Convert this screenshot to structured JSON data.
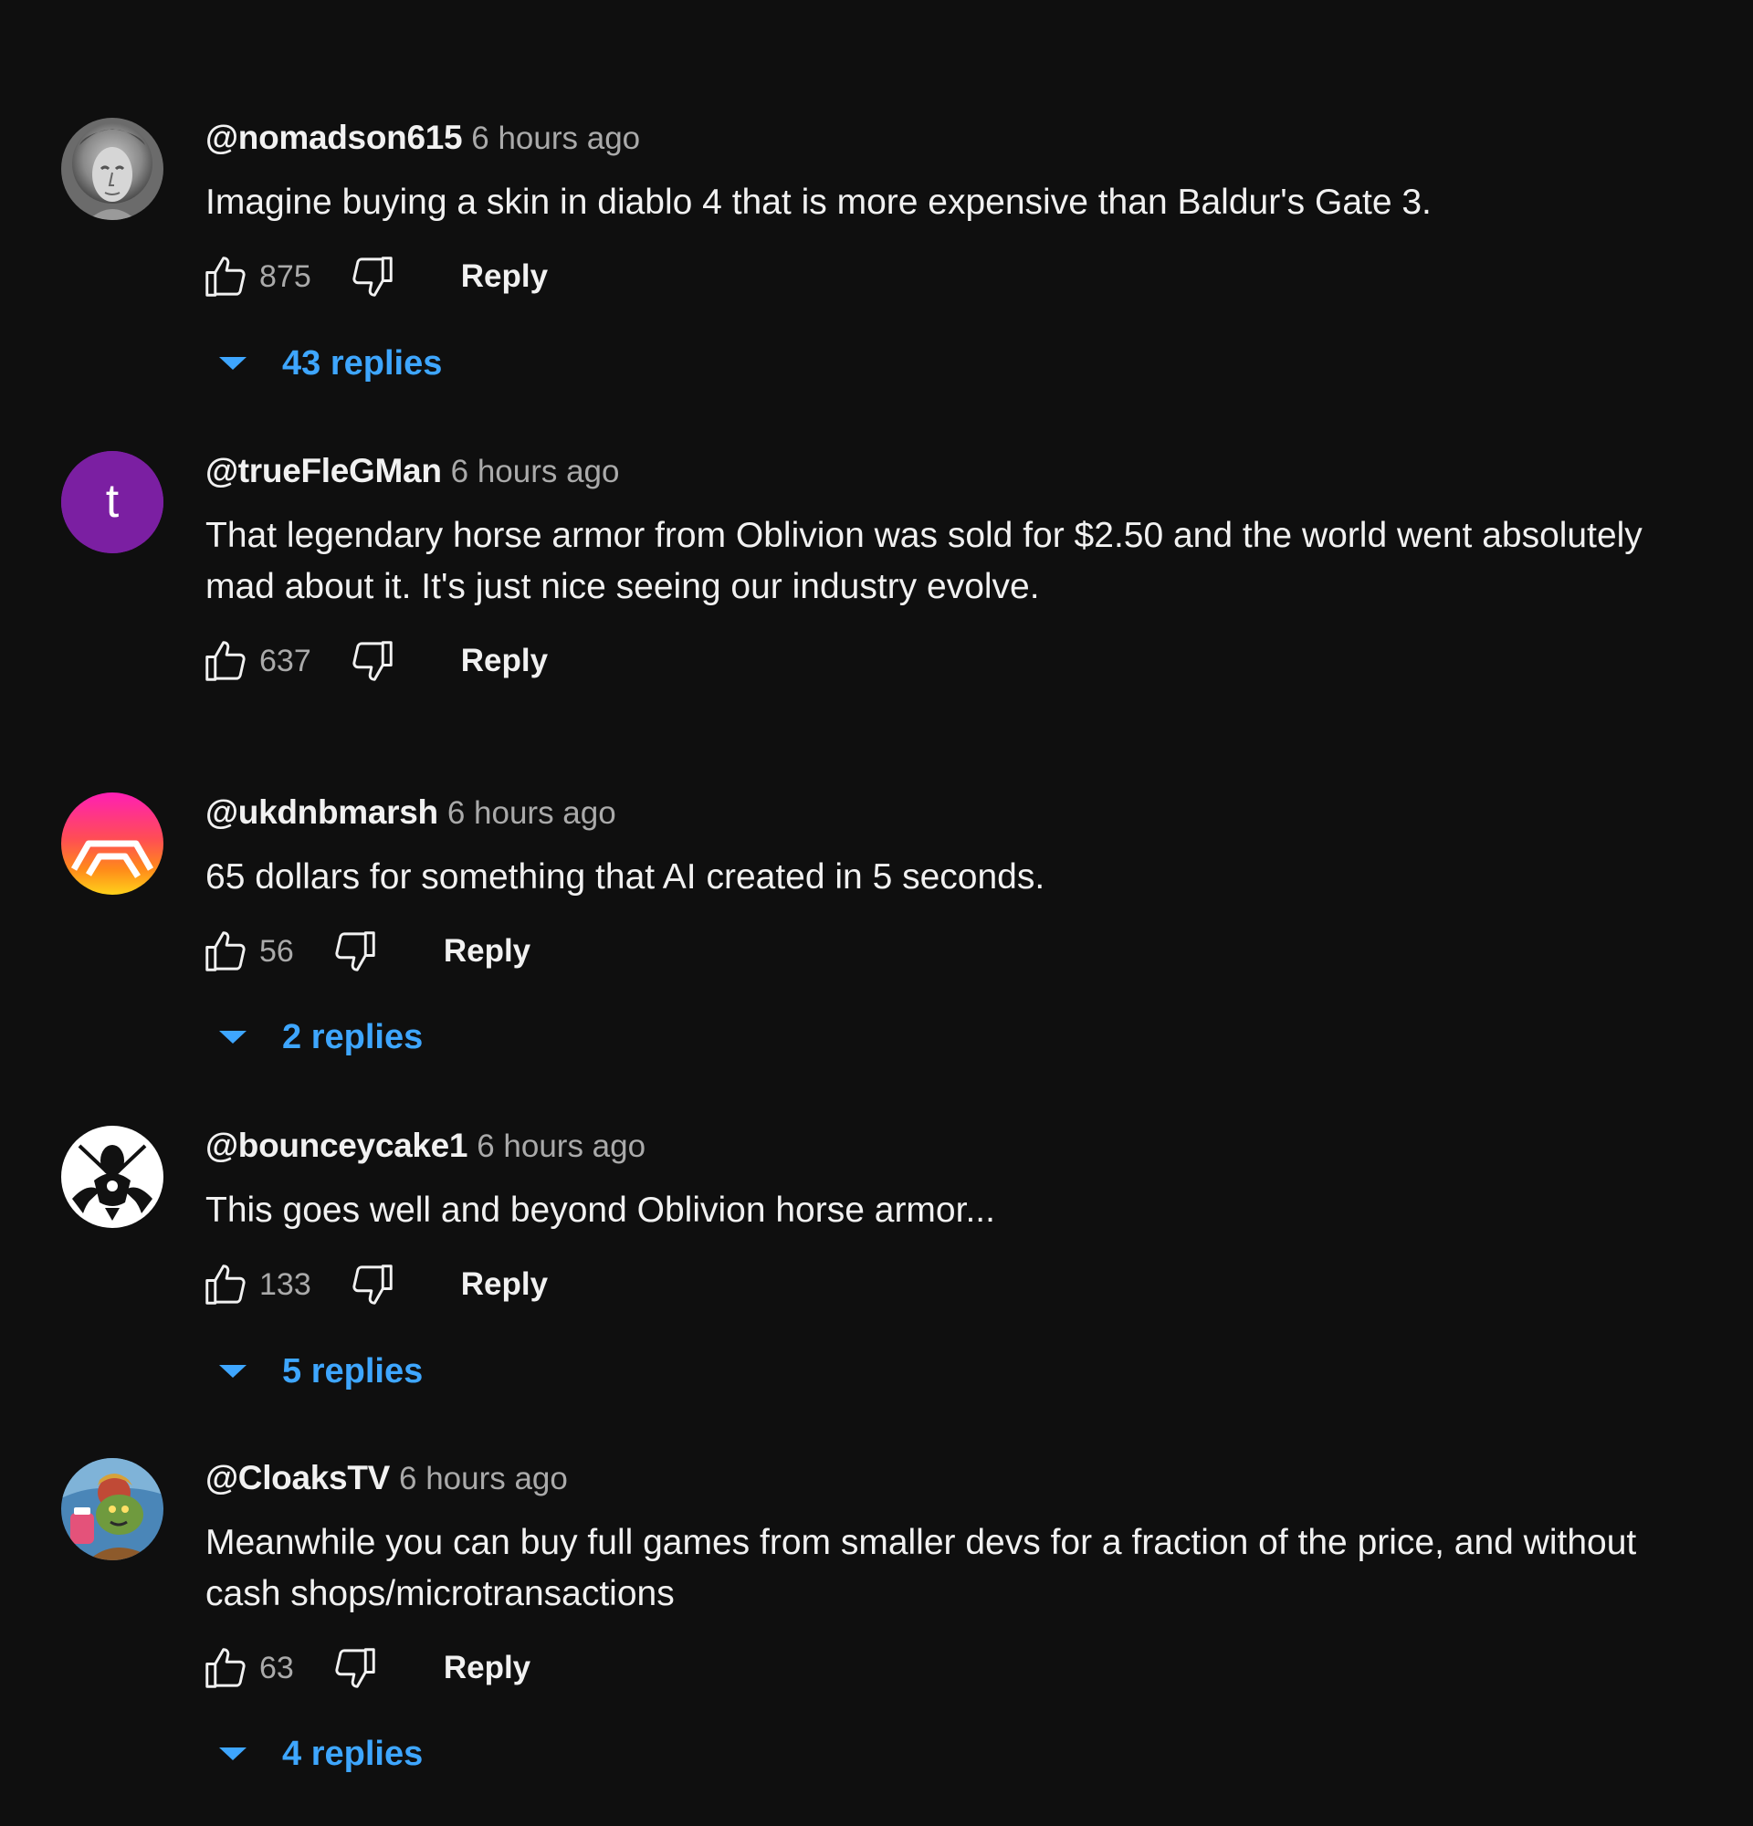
{
  "colors": {
    "background": "#0f0f0f",
    "text_primary": "#f1f1f1",
    "text_secondary": "#aaaaaa",
    "accent_link": "#3ea6ff"
  },
  "comments": [
    {
      "author": "@nomadson615",
      "time": "6 hours ago",
      "text": "Imagine buying a skin in diablo 4 that is more expensive than Baldur's Gate 3.",
      "likes": "875",
      "reply_label": "Reply",
      "replies_label": "43 replies",
      "avatar": "statue-bust-avatar"
    },
    {
      "author": "@trueFleGMan",
      "time": "6 hours ago",
      "text": "That legendary horse armor from Oblivion was sold for $2.50 and the world went absolutely mad about it. It's just nice seeing our industry evolve.",
      "likes": "637",
      "reply_label": "Reply",
      "avatar_letter": "t",
      "avatar_color": "#7b1fa2"
    },
    {
      "author": "@ukdnbmarsh",
      "time": "6 hours ago",
      "text": "65 dollars for something that AI created in 5 seconds.",
      "likes": "56",
      "reply_label": "Reply",
      "replies_label": "2 replies",
      "avatar": "gradient-hex-logo-avatar"
    },
    {
      "author": "@bounceycake1",
      "time": "6 hours ago",
      "text": "This goes well and beyond Oblivion horse armor...",
      "likes": "133",
      "reply_label": "Reply",
      "replies_label": "5 replies",
      "avatar": "black-white-emblem-avatar"
    },
    {
      "author": "@CloaksTV",
      "time": "6 hours ago",
      "text": "Meanwhile you can buy full games from smaller devs for a fraction of the price, and without cash shops/microtransactions",
      "likes": "63",
      "reply_label": "Reply",
      "replies_label": "4 replies",
      "avatar": "cartoon-character-avatar"
    }
  ],
  "icons": {
    "like": "thumbs-up-icon",
    "dislike": "thumbs-down-icon",
    "expand": "caret-down-icon"
  }
}
